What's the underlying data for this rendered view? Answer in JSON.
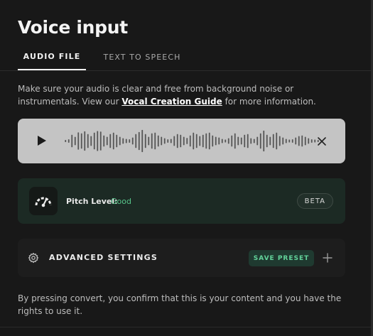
{
  "page": {
    "title": "Voice input"
  },
  "tabs": [
    {
      "label": "AUDIO FILE",
      "active": true
    },
    {
      "label": "TEXT TO SPEECH",
      "active": false
    }
  ],
  "helper": {
    "prefix": "Make sure your audio is clear and free from background noise or instrumentals. View our ",
    "link": "Vocal Creation Guide",
    "suffix": " for more information."
  },
  "player": {
    "play_icon": "play-icon",
    "close_icon": "close-icon",
    "waveform_amplitudes": [
      0.08,
      0.12,
      0.45,
      0.3,
      0.62,
      0.55,
      0.7,
      0.5,
      0.35,
      0.6,
      0.72,
      0.68,
      0.4,
      0.3,
      0.5,
      0.6,
      0.45,
      0.3,
      0.2,
      0.15,
      0.12,
      0.25,
      0.5,
      0.65,
      0.8,
      0.5,
      0.3,
      0.55,
      0.6,
      0.4,
      0.3,
      0.2,
      0.12,
      0.15,
      0.35,
      0.5,
      0.45,
      0.3,
      0.22,
      0.4,
      0.6,
      0.5,
      0.35,
      0.45,
      0.55,
      0.6,
      0.4,
      0.3,
      0.25,
      0.15,
      0.1,
      0.2,
      0.4,
      0.55,
      0.3,
      0.25,
      0.45,
      0.5,
      0.2,
      0.15,
      0.3,
      0.55,
      0.75,
      0.45,
      0.3,
      0.5,
      0.6,
      0.35,
      0.25,
      0.15,
      0.1,
      0.12,
      0.25,
      0.35,
      0.4,
      0.3,
      0.2,
      0.12,
      0.1,
      0.08
    ],
    "colors": {
      "background": "#c4c4c4",
      "wave": "#555555"
    }
  },
  "pitch": {
    "label": "Pitch Level:",
    "value": "Good",
    "badge": "BETA",
    "icon": "gauge-icon",
    "colors": {
      "value": "#57c58a",
      "background": "#1c2a24"
    }
  },
  "advanced": {
    "label": "ADVANCED SETTINGS",
    "save_label": "SAVE PRESET",
    "icon": "gear-icon",
    "add_icon": "plus-icon",
    "colors": {
      "save_text": "#62d39a",
      "save_bg": "#1f3a30"
    }
  },
  "consent": {
    "text": "By pressing convert, you confirm that this is your content and you have the rights to use it."
  }
}
